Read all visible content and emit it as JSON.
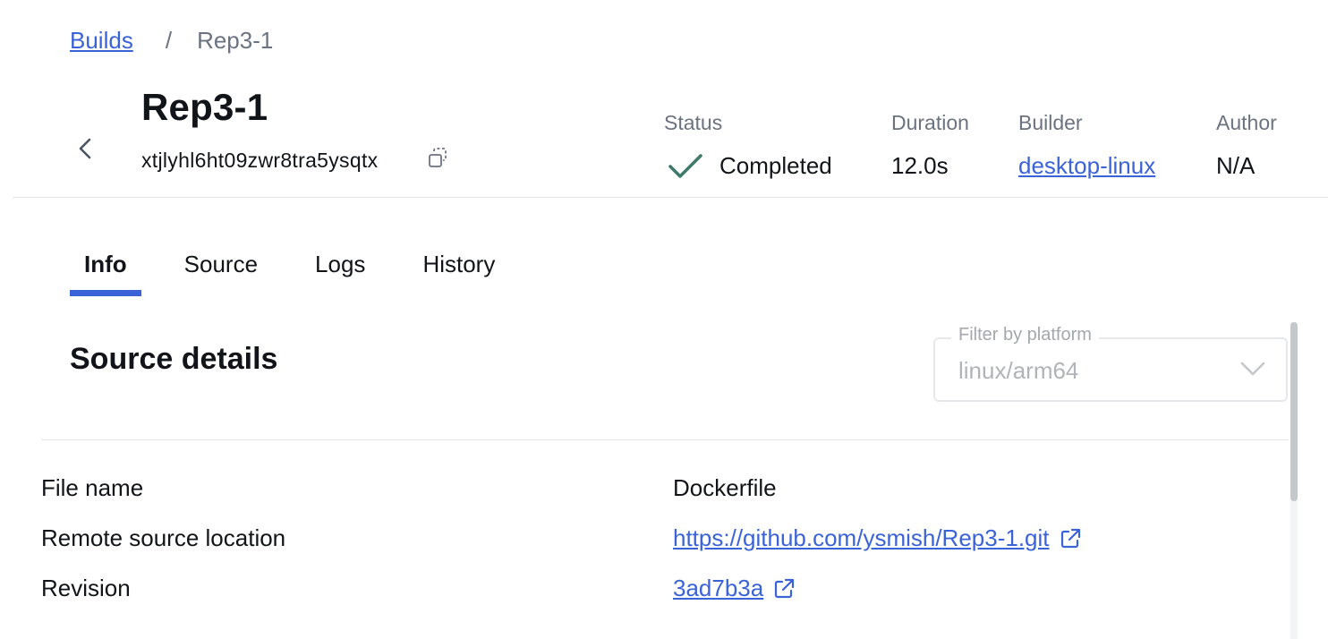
{
  "breadcrumb": {
    "root": "Builds",
    "separator": "/",
    "current": "Rep3-1"
  },
  "header": {
    "title": "Rep3-1",
    "build_id": "xtjlyhl6ht09zwr8tra5ysqtx",
    "back_icon": "chevron-left-icon",
    "copy_icon": "copy-icon"
  },
  "meta": {
    "status_label": "Status",
    "status_value": "Completed",
    "status_icon": "check-icon",
    "status_color": "#3f7a6b",
    "duration_label": "Duration",
    "duration_value": "12.0s",
    "builder_label": "Builder",
    "builder_value": "desktop-linux",
    "author_label": "Author",
    "author_value": "N/A"
  },
  "tabs": [
    {
      "label": "Info",
      "active": true
    },
    {
      "label": "Source",
      "active": false
    },
    {
      "label": "Logs",
      "active": false
    },
    {
      "label": "History",
      "active": false
    }
  ],
  "section": {
    "title": "Source details",
    "filter": {
      "label": "Filter by platform",
      "value": "linux/arm64"
    }
  },
  "details": [
    {
      "label": "File name",
      "value": "Dockerfile",
      "link": false
    },
    {
      "label": "Remote source location",
      "value": "https://github.com/ysmish/Rep3-1.git",
      "link": true
    },
    {
      "label": "Revision",
      "value": "3ad7b3a",
      "link": true
    }
  ],
  "colors": {
    "accent": "#3b63d8",
    "muted": "#6b7280",
    "divider": "#e5e7eb"
  }
}
